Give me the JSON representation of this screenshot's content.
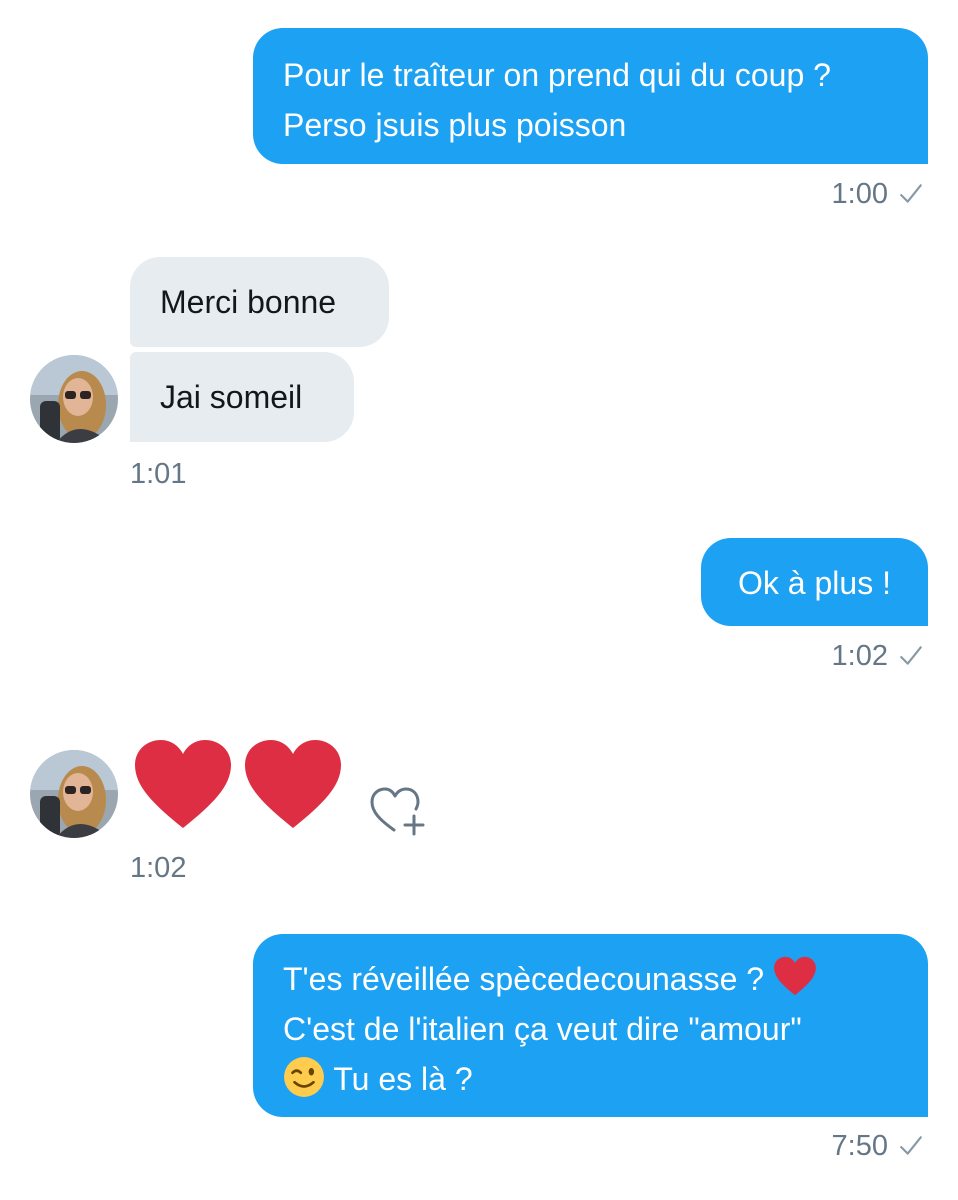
{
  "conversation": {
    "messages": [
      {
        "direction": "outgoing",
        "lines": [
          "Pour le traîteur on prend qui du coup ?",
          "Perso jsuis plus poisson"
        ],
        "time": "1:00"
      },
      {
        "direction": "incoming",
        "text": "Merci bonne"
      },
      {
        "direction": "incoming",
        "text": "Jai someil",
        "time": "1:01"
      },
      {
        "direction": "outgoing",
        "text": "Ok à plus !",
        "time": "1:02"
      },
      {
        "direction": "incoming",
        "emoji": [
          "red-heart",
          "red-heart"
        ],
        "time": "1:02"
      },
      {
        "direction": "outgoing",
        "lines": [
          "T'es réveillée spècedecounasse ?",
          "C'est de l'italien ça veut dire \"amour\"",
          "Tu es là ?"
        ],
        "time": "7:50"
      }
    ]
  },
  "icons": {
    "sent_check": "check-icon",
    "add_reaction": "heart-plus-icon",
    "emoji_heart": "red-heart-emoji",
    "emoji_wink": "winking-face-emoji"
  },
  "colors": {
    "outgoing_bubble": "#1da1f2",
    "incoming_bubble": "#e6ecf0",
    "timestamp": "#657786",
    "heart": "#e0245e"
  }
}
